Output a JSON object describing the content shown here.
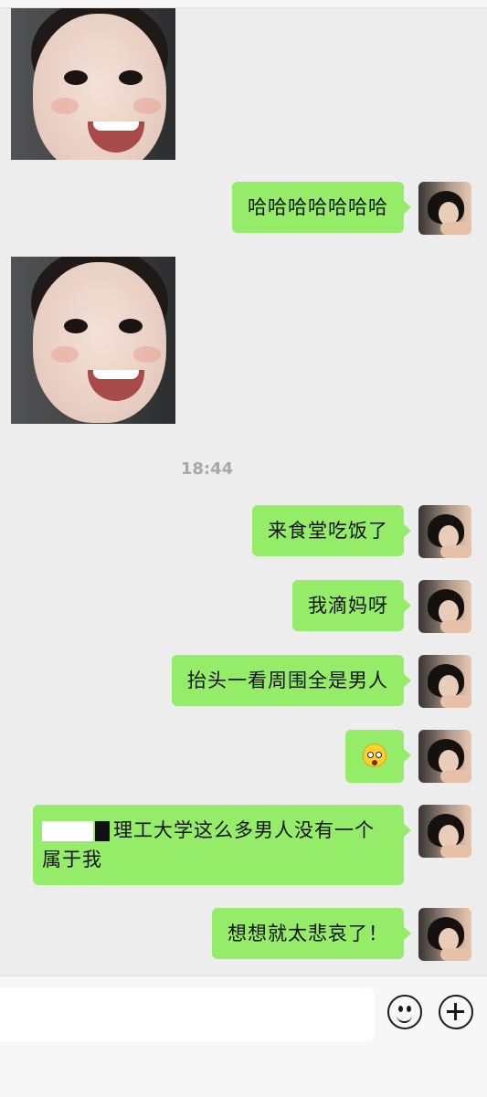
{
  "messages": [
    {
      "type": "sticker",
      "side": "other"
    },
    {
      "type": "text",
      "side": "self",
      "text": "哈哈哈哈哈哈哈"
    },
    {
      "type": "sticker",
      "side": "other"
    },
    {
      "type": "time",
      "text": "18:44"
    },
    {
      "type": "text",
      "side": "self",
      "text": "来食堂吃饭了"
    },
    {
      "type": "text",
      "side": "self",
      "text": "我滴妈呀"
    },
    {
      "type": "text",
      "side": "self",
      "text": "抬头一看周围全是男人"
    },
    {
      "type": "emoji",
      "side": "self",
      "icon": "flushed-face-emoji"
    },
    {
      "type": "text",
      "side": "self",
      "line1": "理工大学这么多男人没有一个",
      "line2": "属于我"
    },
    {
      "type": "text",
      "side": "self",
      "text": "想想就太悲哀了！"
    }
  ],
  "input_bar": {
    "icons": [
      "emoji-smile-icon",
      "plus-icon"
    ]
  },
  "colors": {
    "background": "#ededed",
    "self_bubble": "#95ec69",
    "timestamp": "#a8a8a8"
  }
}
